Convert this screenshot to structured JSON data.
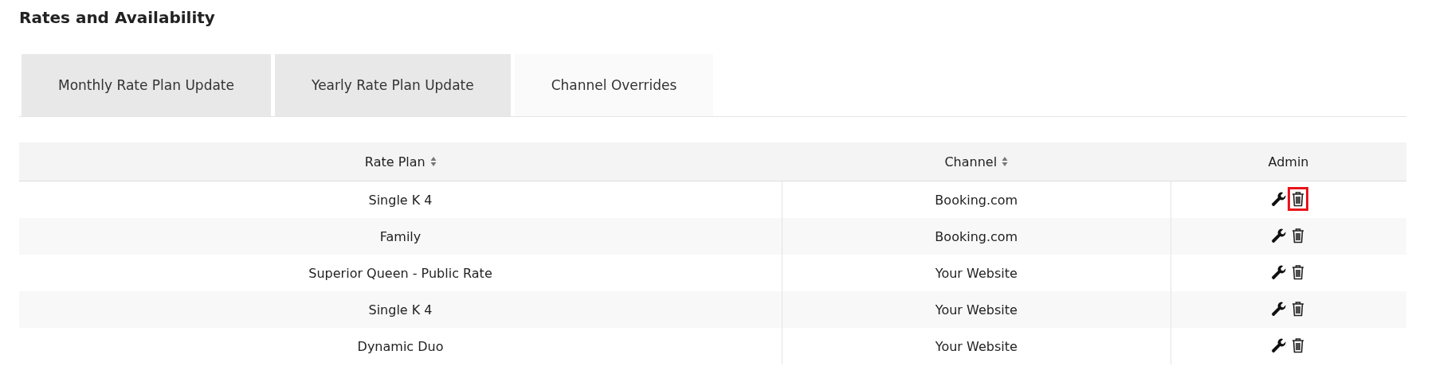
{
  "page": {
    "title": "Rates and Availability"
  },
  "tabs": [
    {
      "label": "Monthly Rate Plan Update",
      "selected": false
    },
    {
      "label": "Yearly Rate Plan Update",
      "selected": false
    },
    {
      "label": "Channel Overrides",
      "selected": true
    }
  ],
  "table": {
    "columns": [
      {
        "label": "Rate Plan",
        "sortable": true
      },
      {
        "label": "Channel",
        "sortable": true
      },
      {
        "label": "Admin",
        "sortable": false
      }
    ],
    "rows": [
      {
        "rate_plan": "Single K 4",
        "channel": "Booking.com",
        "delete_highlighted": true
      },
      {
        "rate_plan": "Family",
        "channel": "Booking.com",
        "delete_highlighted": false
      },
      {
        "rate_plan": "Superior Queen - Public Rate",
        "channel": "Your Website",
        "delete_highlighted": false
      },
      {
        "rate_plan": "Single K 4",
        "channel": "Your Website",
        "delete_highlighted": false
      },
      {
        "rate_plan": "Dynamic Duo",
        "channel": "Your Website",
        "delete_highlighted": false
      }
    ]
  }
}
